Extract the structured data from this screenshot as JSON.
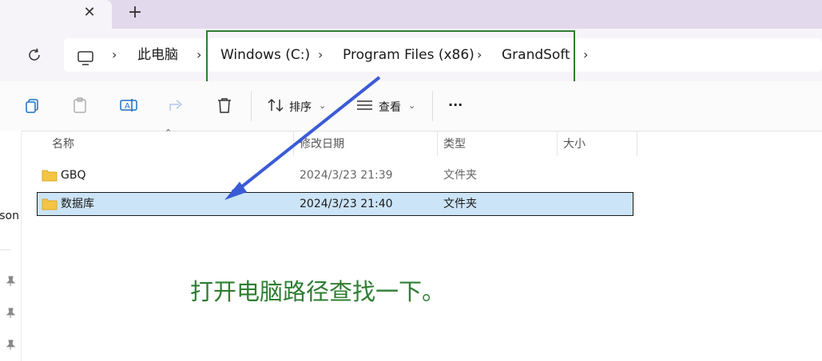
{
  "tab": {
    "close_icon": "close-icon",
    "add_icon": "plus-icon"
  },
  "breadcrumb": {
    "items": [
      "此电脑",
      "Windows (C:)",
      "Program Files (x86)",
      "GrandSoft"
    ],
    "separator": "›"
  },
  "toolbar": {
    "sort_label": "排序",
    "view_label": "查看",
    "more_label": "···"
  },
  "sidebar": {
    "partial_text": "Person"
  },
  "columns": [
    "名称",
    "修改日期",
    "类型",
    "大小"
  ],
  "rows": [
    {
      "name": "GBQ",
      "date": "2024/3/23 21:39",
      "type": "文件夹",
      "size": "",
      "selected": false
    },
    {
      "name": "数据库",
      "date": "2024/3/23 21:40",
      "type": "文件夹",
      "size": "",
      "selected": true
    }
  ],
  "annotation": {
    "text": "打开电脑路径查找一下。"
  },
  "colors": {
    "annotation_green": "#2e7d32",
    "arrow_blue": "#3b5bd6",
    "selected_row": "#cce4f7",
    "folder_yellow": "#f4c542"
  }
}
